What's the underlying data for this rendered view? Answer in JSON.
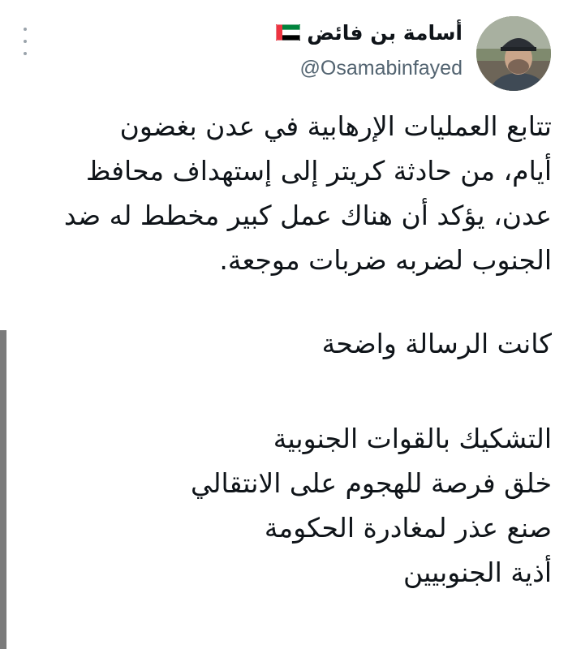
{
  "author": {
    "display_name": "أسامة بن فائض",
    "handle": "@Osamabinfayed",
    "flag_icon": "uae-flag-icon",
    "avatar_icon": "user-avatar"
  },
  "tweet": {
    "paragraph1": [
      "تتابع العمليات الإرهابية في عدن بغضون",
      "أيام، من حادثة كريتر إلى إستهداف محافظ",
      "عدن، يؤكد أن هناك عمل كبير مخطط له ضد",
      "الجنوب لضربه ضربات موجعة."
    ],
    "paragraph2": "كانت الرسالة واضحة",
    "list": [
      "التشكيك بالقوات الجنوبية",
      "خلق فرصة للهجوم على الانتقالي",
      "صنع عذر لمغادرة الحكومة",
      "أذية الجنوبيين"
    ]
  },
  "menu": {
    "icon": "more-options-icon"
  }
}
